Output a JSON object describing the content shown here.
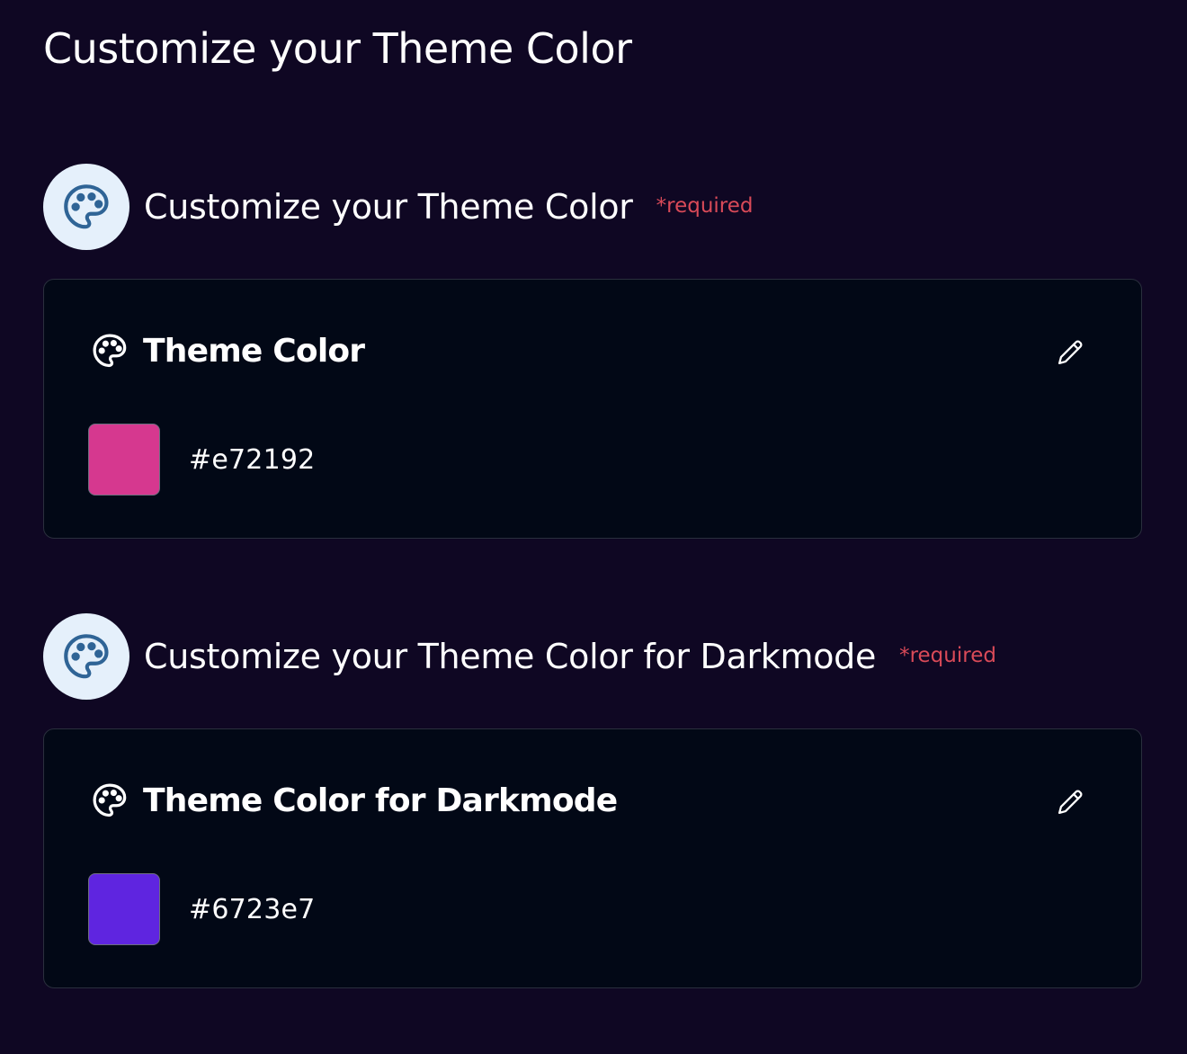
{
  "page": {
    "title": "Customize your Theme Color"
  },
  "sections": [
    {
      "heading": "Customize your Theme Color",
      "required_label": "*required",
      "icon": "palette-icon",
      "card": {
        "title": "Theme Color",
        "icon": "palette-icon",
        "edit_icon": "pencil-icon",
        "color_hex": "#e72192",
        "swatch_color": "#d6388f"
      }
    },
    {
      "heading": "Customize your Theme Color for Darkmode",
      "required_label": "*required",
      "icon": "palette-icon",
      "card": {
        "title": "Theme Color for Darkmode",
        "icon": "palette-icon",
        "edit_icon": "pencil-icon",
        "color_hex": "#6723e7",
        "swatch_color": "#5f25e0"
      }
    }
  ],
  "colors": {
    "background": "#0f0723",
    "card_background": "#020816",
    "card_border": "#2a2f3d",
    "required_text": "#d94a58",
    "icon_circle": "#e5f0fb",
    "icon_stroke": "#2f6496"
  }
}
